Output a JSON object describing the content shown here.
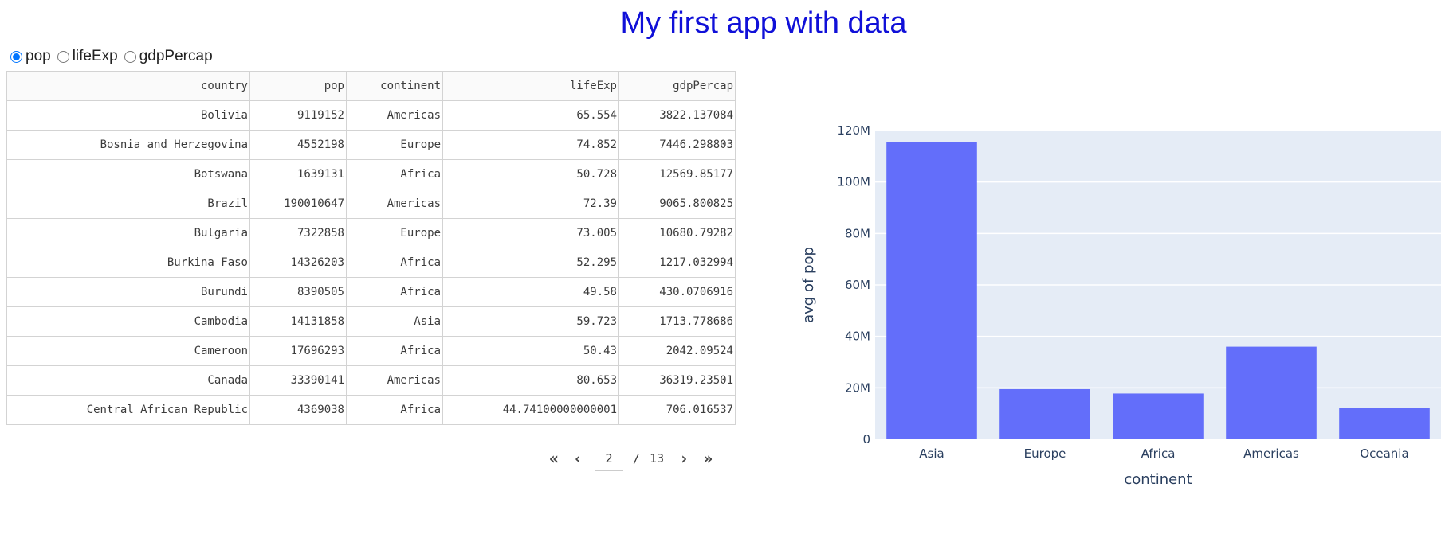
{
  "app": {
    "title": "My first app with data"
  },
  "radio": {
    "options": [
      {
        "label": "pop",
        "checked": true
      },
      {
        "label": "lifeExp",
        "checked": false
      },
      {
        "label": "gdpPercap",
        "checked": false
      }
    ]
  },
  "table": {
    "columns": [
      "country",
      "pop",
      "continent",
      "lifeExp",
      "gdpPercap"
    ],
    "rows": [
      [
        "Bolivia",
        "9119152",
        "Americas",
        "65.554",
        "3822.137084"
      ],
      [
        "Bosnia and Herzegovina",
        "4552198",
        "Europe",
        "74.852",
        "7446.298803"
      ],
      [
        "Botswana",
        "1639131",
        "Africa",
        "50.728",
        "12569.85177"
      ],
      [
        "Brazil",
        "190010647",
        "Americas",
        "72.39",
        "9065.800825"
      ],
      [
        "Bulgaria",
        "7322858",
        "Europe",
        "73.005",
        "10680.79282"
      ],
      [
        "Burkina Faso",
        "14326203",
        "Africa",
        "52.295",
        "1217.032994"
      ],
      [
        "Burundi",
        "8390505",
        "Africa",
        "49.58",
        "430.0706916"
      ],
      [
        "Cambodia",
        "14131858",
        "Asia",
        "59.723",
        "1713.778686"
      ],
      [
        "Cameroon",
        "17696293",
        "Africa",
        "50.43",
        "2042.09524"
      ],
      [
        "Canada",
        "33390141",
        "Americas",
        "80.653",
        "36319.23501"
      ],
      [
        "Central African Republic",
        "4369038",
        "Africa",
        "44.74100000000001",
        "706.016537"
      ]
    ]
  },
  "pagination": {
    "first": "«",
    "prev": "‹",
    "current": "2",
    "separator": "/",
    "total": "13",
    "next": "›",
    "last": "»"
  },
  "chart_data": {
    "type": "bar",
    "categories": [
      "Asia",
      "Europe",
      "Africa",
      "Americas",
      "Oceania"
    ],
    "values": [
      115500000,
      19500000,
      17800000,
      36000000,
      12300000
    ],
    "xlabel": "continent",
    "ylabel": "avg of pop",
    "ylim": [
      0,
      120000000
    ],
    "yticks": [
      0,
      20000000,
      40000000,
      60000000,
      80000000,
      100000000,
      120000000
    ],
    "ytick_labels": [
      "0",
      "20M",
      "40M",
      "60M",
      "80M",
      "100M",
      "120M"
    ],
    "bar_color": "#636efa",
    "plot_bg": "#e5ecf6",
    "grid": true
  },
  "colors": {
    "title": "#1010d8"
  }
}
